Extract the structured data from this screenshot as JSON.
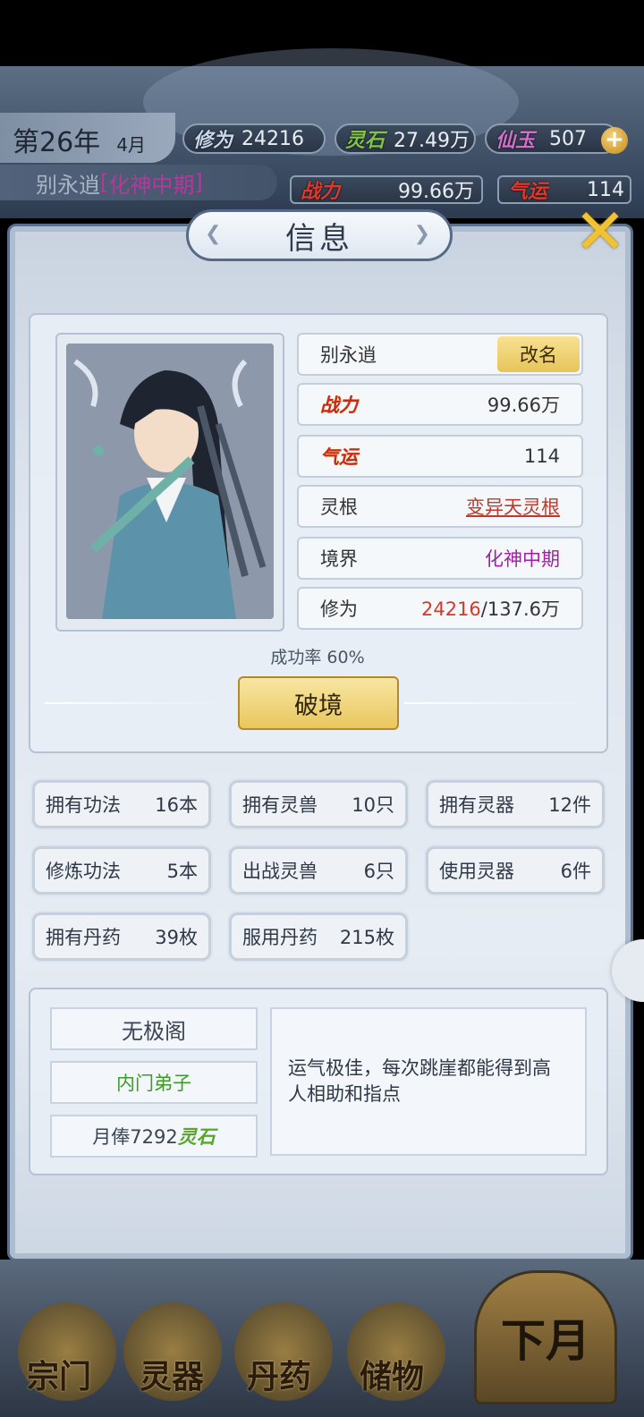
{
  "header": {
    "year": "第26年",
    "month": "4月",
    "cultivation": {
      "label": "修为",
      "value": "24216"
    },
    "spirit_stone": {
      "label": "灵石",
      "value": "27.49万"
    },
    "jade": {
      "label": "仙玉",
      "value": "507"
    },
    "plus": "+",
    "power": {
      "label": "战力",
      "value": "99.66万"
    },
    "luck": {
      "label": "气运",
      "value": "114"
    },
    "char_name": "别永逍",
    "realm_bracket_open": "[",
    "realm": "化神中期",
    "realm_bracket_close": "]"
  },
  "panel": {
    "title": "信息",
    "close": "✕"
  },
  "profile": {
    "name": "别永逍",
    "rename_button": "改名",
    "power_label": "战力",
    "power_value": "99.66万",
    "luck_label": "气运",
    "luck_value": "114",
    "root_label": "灵根",
    "root_value": "变异天灵根",
    "realm_label": "境界",
    "realm_value": "化神中期",
    "cult_label": "修为",
    "cult_current": "24216",
    "cult_max": "/137.6万",
    "success_rate": "成功率 60%",
    "breakthrough_button": "破境"
  },
  "stats": [
    {
      "label": "拥有功法",
      "value": "16本"
    },
    {
      "label": "拥有灵兽",
      "value": "10只"
    },
    {
      "label": "拥有灵器",
      "value": "12件"
    },
    {
      "label": "修炼功法",
      "value": "5本"
    },
    {
      "label": "出战灵兽",
      "value": "6只"
    },
    {
      "label": "使用灵器",
      "value": "6件"
    },
    {
      "label": "拥有丹药",
      "value": "39枚"
    },
    {
      "label": "服用丹药",
      "value": "215枚"
    }
  ],
  "sect": {
    "name": "无极阁",
    "rank": "内门弟子",
    "salary_prefix": "月俸7292",
    "salary_unit": "灵石",
    "description": "运气极佳，每次跳崖都能得到高人相助和指点"
  },
  "bottom_nav": {
    "items": [
      "宗门",
      "灵器",
      "丹药",
      "储物"
    ],
    "next_month": "下月"
  },
  "colors": {
    "panel_border": "#5a6f8c",
    "gold_button": "#e9c75e",
    "root_red": "#c0392b",
    "realm_purple": "#a020a0",
    "cult_red": "#d0392b",
    "rank_green": "#3f9a2a"
  }
}
